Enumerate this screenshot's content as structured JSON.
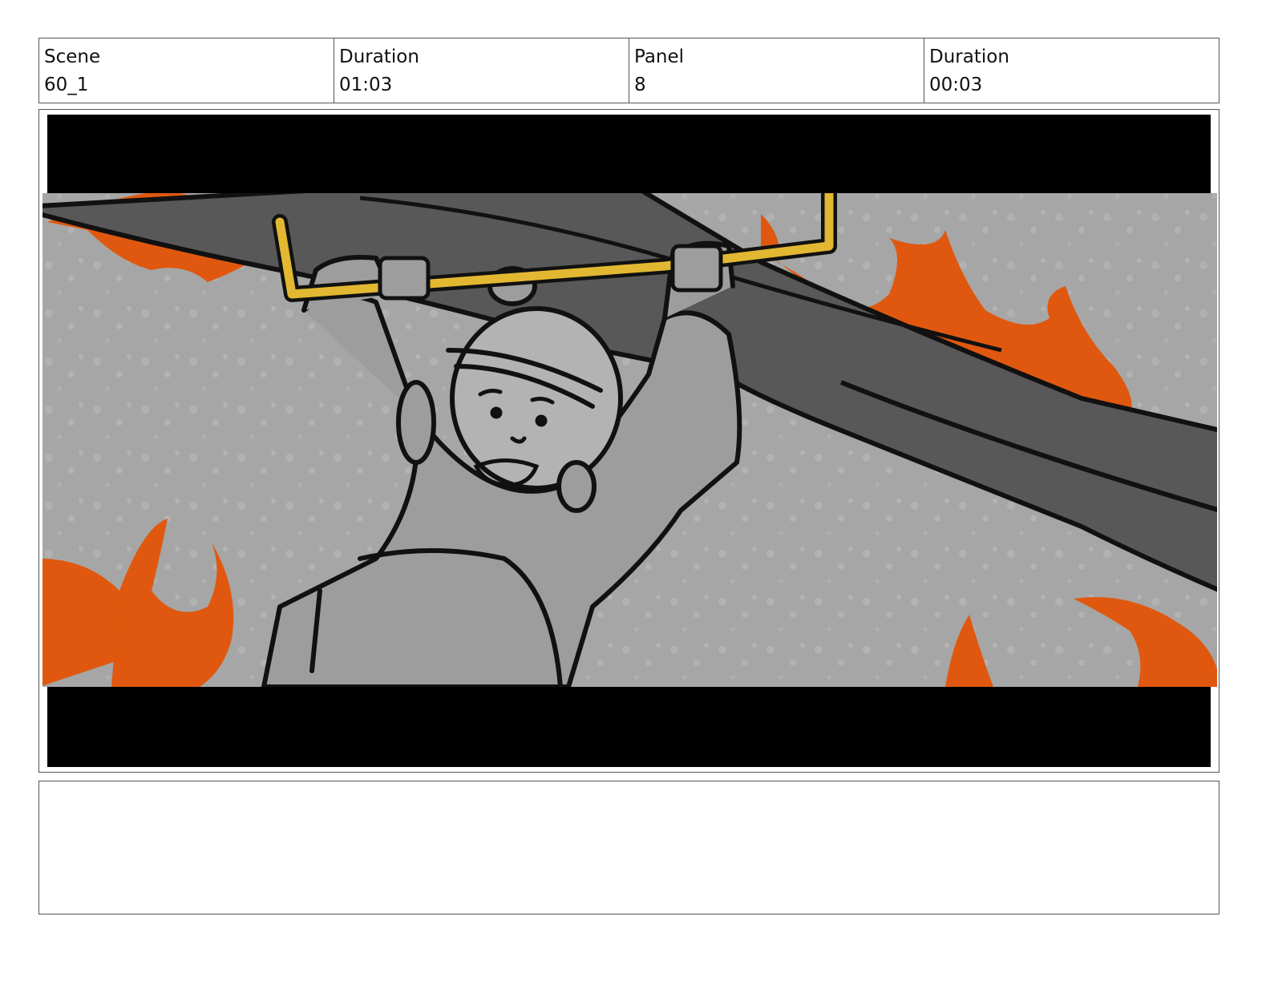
{
  "header": {
    "cells": [
      {
        "label": "Scene",
        "value": "60_1"
      },
      {
        "label": "Duration",
        "value": "01:03"
      },
      {
        "label": "Panel",
        "value": "8"
      },
      {
        "label": "Duration",
        "value": "00:03"
      }
    ]
  },
  "panel": {
    "colors": {
      "letterbox": "#000000",
      "sky": "#a6a6a6",
      "flame": "#e0580f",
      "beam": "#555555",
      "bar": "#e2b832",
      "outline": "#111111"
    }
  },
  "notes": {
    "text": ""
  }
}
